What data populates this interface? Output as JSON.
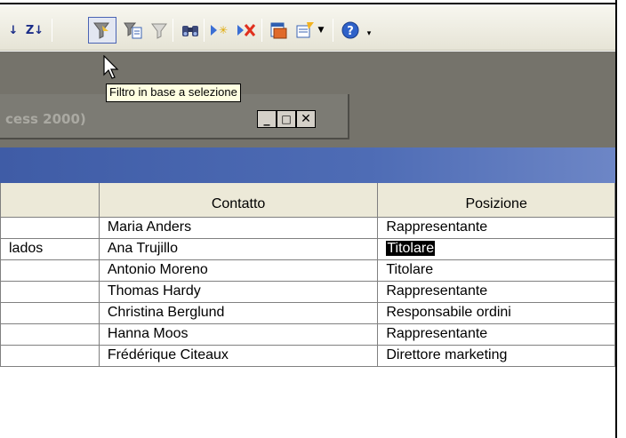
{
  "toolbar": {
    "buttons": [
      {
        "name": "sort-ascending",
        "label": "↓"
      },
      {
        "name": "sort-descending",
        "label": "Z↓"
      },
      {
        "name": "filter-by-selection",
        "pressed": true
      },
      {
        "name": "filter-by-form"
      },
      {
        "name": "apply-filter"
      },
      {
        "name": "find"
      },
      {
        "name": "new-record"
      },
      {
        "name": "delete-record"
      },
      {
        "name": "database-window"
      },
      {
        "name": "new-object"
      },
      {
        "name": "help"
      }
    ]
  },
  "tooltip": {
    "text": "Filtro in base a selezione"
  },
  "document": {
    "title_fragment": "cess 2000)"
  },
  "table": {
    "columns": [
      "",
      "Contatto",
      "Posizione"
    ],
    "rows": [
      [
        "",
        "Maria Anders",
        "Rappresentante"
      ],
      [
        "lados",
        "Ana Trujillo",
        "Titolare"
      ],
      [
        "",
        "Antonio Moreno",
        "Titolare"
      ],
      [
        "",
        "Thomas Hardy",
        "Rappresentante"
      ],
      [
        "",
        "Christina Berglund",
        "Responsabile ordini"
      ],
      [
        "",
        "Hanna Moos",
        "Rappresentante"
      ],
      [
        "",
        "Frédérique Citeaux",
        "Direttore marketing"
      ]
    ],
    "selected_cell": {
      "row": 1,
      "col": 2
    }
  },
  "colors": {
    "toolbar": "#ece9d8",
    "workspace": "#75736b",
    "band": "#4e6cb5",
    "tooltip": "#ffffe1",
    "selection": "#000000"
  }
}
